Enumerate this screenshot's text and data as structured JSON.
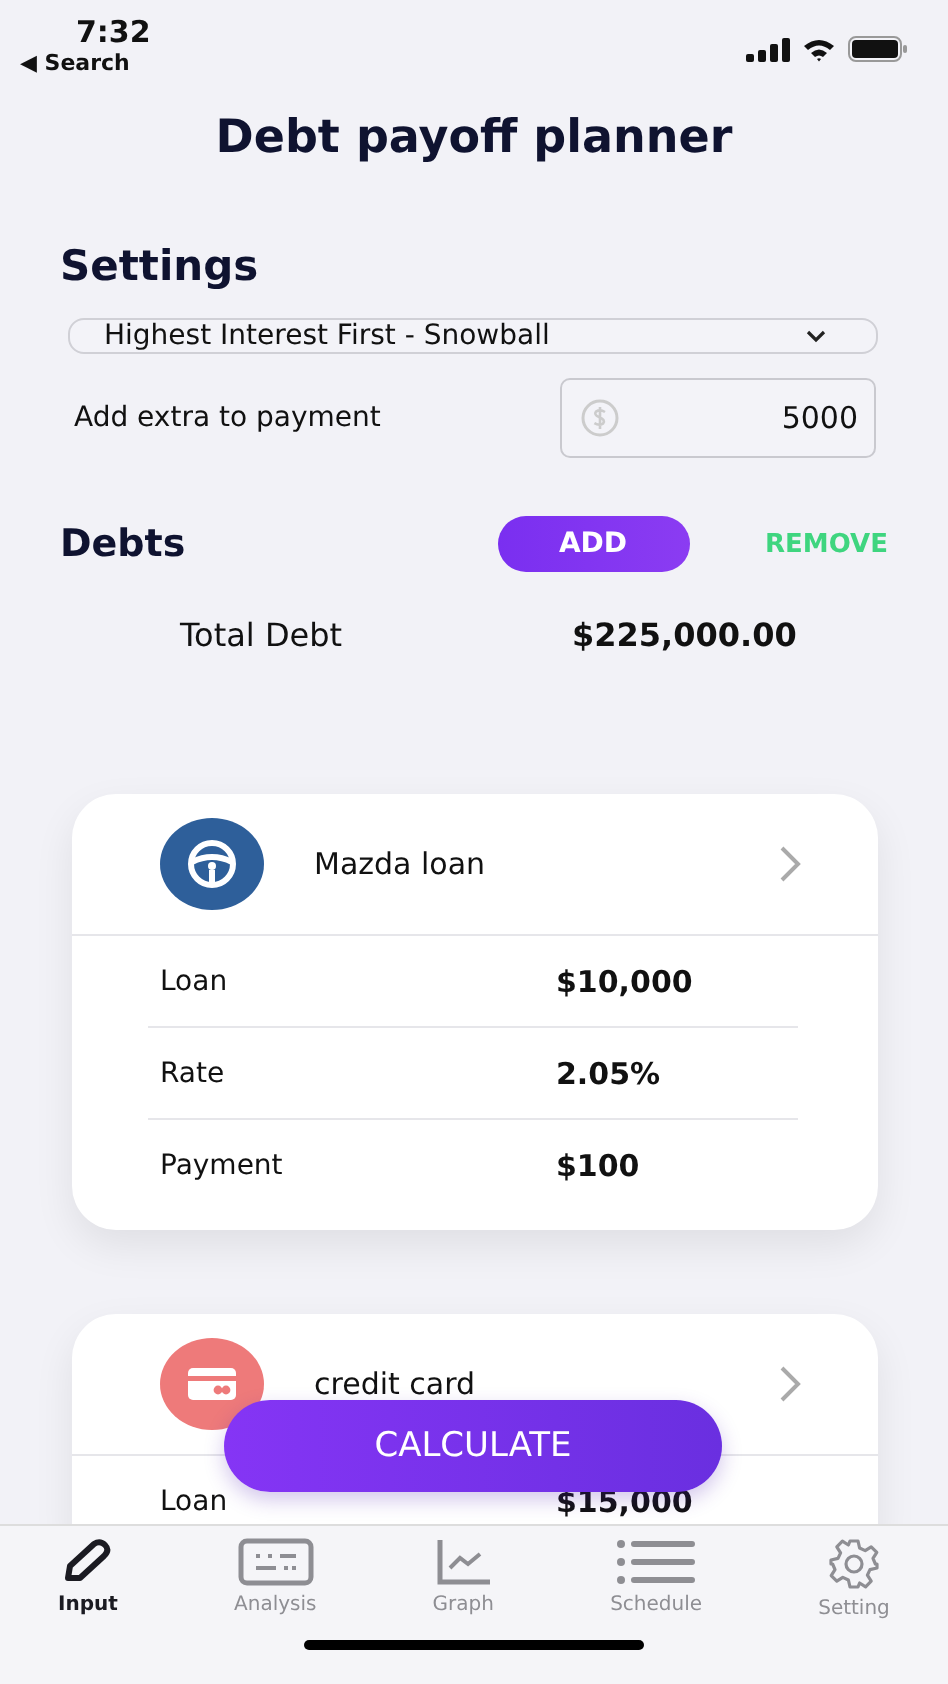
{
  "status_bar": {
    "time": "7:32",
    "back_label": "◀ Search"
  },
  "title": "Debt payoff planner",
  "settings": {
    "heading": "Settings",
    "strategy": "Highest Interest First - Snowball",
    "extra_label": "Add extra to payment",
    "extra_value": "5000"
  },
  "debts": {
    "heading": "Debts",
    "add_label": "ADD",
    "remove_label": "REMOVE",
    "total_label": "Total Debt",
    "total_value": "$225,000.00"
  },
  "debt_cards": [
    {
      "name": "Mazda loan",
      "kind": "steering",
      "color": "#2e5f9a",
      "rows": [
        {
          "label": "Loan",
          "value": "$10,000"
        },
        {
          "label": "Rate",
          "value": "2.05%"
        },
        {
          "label": "Payment",
          "value": "$100"
        }
      ]
    },
    {
      "name": "credit card",
      "kind": "card",
      "color": "#ee7a7a",
      "rows": [
        {
          "label": "Loan",
          "value": "$15,000"
        }
      ]
    }
  ],
  "calculate_label": "CALCULATE",
  "tabs": [
    {
      "label": "Input",
      "kind": "pencil",
      "selected": true
    },
    {
      "label": "Analysis",
      "kind": "keyboard",
      "selected": false
    },
    {
      "label": "Graph",
      "kind": "graph",
      "selected": false
    },
    {
      "label": "Schedule",
      "kind": "list",
      "selected": false
    },
    {
      "label": "Setting",
      "kind": "gear",
      "selected": false
    }
  ]
}
